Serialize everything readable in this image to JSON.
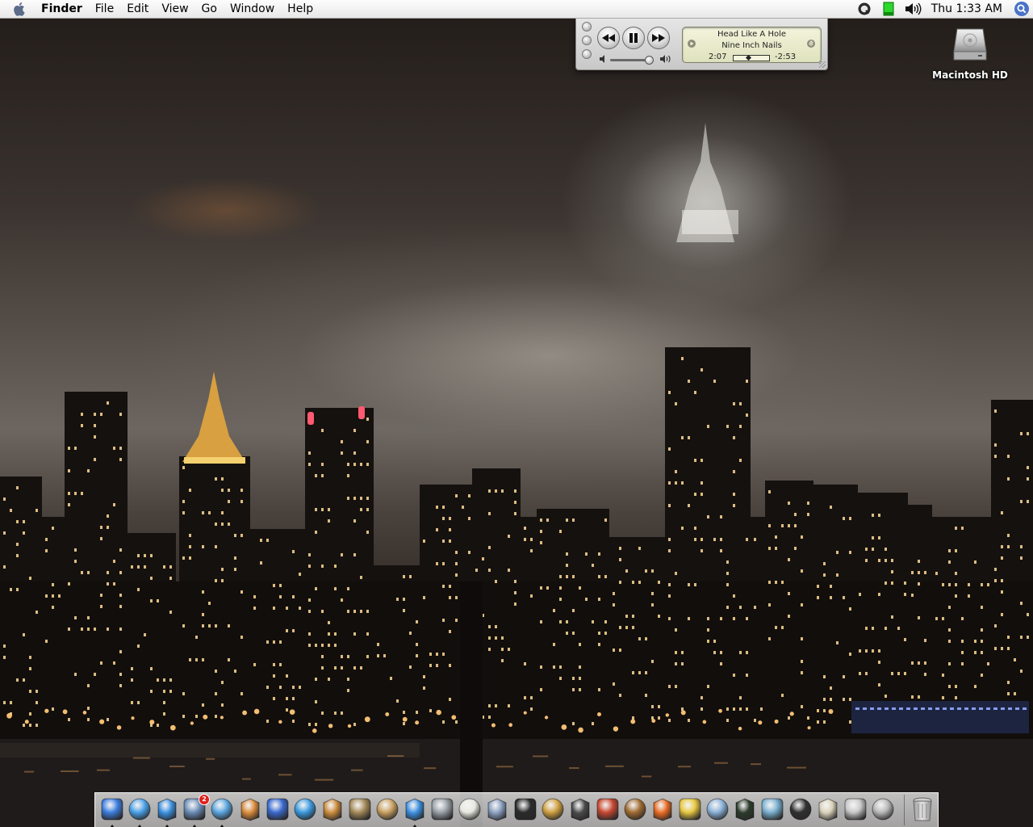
{
  "menubar": {
    "app_name": "Finder",
    "menus": [
      "File",
      "Edit",
      "View",
      "Go",
      "Window",
      "Help"
    ],
    "clock": "Thu 1:33 AM",
    "extras": [
      "quicktime-icon",
      "battery-icon",
      "volume-icon"
    ]
  },
  "itunes": {
    "song_title": "Head Like A Hole",
    "artist": "Nine Inch Nails",
    "time_elapsed": "2:07",
    "time_remaining": "-2:53",
    "progress_fraction": 0.42,
    "volume_fraction": 0.9
  },
  "desktop": {
    "icons": [
      {
        "label": "Macintosh HD",
        "icon": "hard-drive-icon"
      }
    ]
  },
  "dock": {
    "mail_badge": "2",
    "apps": [
      {
        "id": "finder",
        "icon": "finder-icon",
        "running": true,
        "color": "#3d7fe0"
      },
      {
        "id": "safari",
        "icon": "safari-compass-icon",
        "running": true,
        "color": "#4aa0e8"
      },
      {
        "id": "ichat",
        "icon": "ichat-bubble-icon",
        "running": true,
        "color": "#3a8fe0"
      },
      {
        "id": "mail",
        "icon": "mail-stamp-icon",
        "running": true,
        "color": "#6a8db8"
      },
      {
        "id": "itunes",
        "icon": "itunes-note-icon",
        "running": true,
        "color": "#5aa5e0"
      },
      {
        "id": "iphoto",
        "icon": "iphoto-icon",
        "running": false,
        "color": "#d98a3a"
      },
      {
        "id": "imovie",
        "icon": "imovie-clapper-icon",
        "running": false,
        "color": "#3a6ad0"
      },
      {
        "id": "idvd",
        "icon": "idvd-disc-icon",
        "running": false,
        "color": "#3a9ae0"
      },
      {
        "id": "garageband",
        "icon": "guitar-icon",
        "running": false,
        "color": "#c98a3a"
      },
      {
        "id": "preview",
        "icon": "preview-photos-icon",
        "running": false,
        "color": "#a68a5a"
      },
      {
        "id": "address-book",
        "icon": "address-book-icon",
        "running": false,
        "color": "#c9a060"
      },
      {
        "id": "quicktime",
        "icon": "quicktime-q-icon",
        "running": true,
        "color": "#3a8fe0"
      },
      {
        "id": "automator",
        "icon": "automator-robot-icon",
        "running": false,
        "color": "#9aa0a8"
      },
      {
        "id": "textedit",
        "icon": "textedit-icon",
        "running": false,
        "color": "#e8e8e0"
      },
      {
        "id": "photo-booth",
        "icon": "photos-icon",
        "running": false,
        "color": "#8aa0c0"
      },
      {
        "id": "terminal",
        "icon": "terminal-icon",
        "running": false,
        "color": "#2a2a2a"
      },
      {
        "id": "network-utility",
        "icon": "pencil-ruler-icon",
        "running": false,
        "color": "#d0a040"
      },
      {
        "id": "activity-tool",
        "icon": "film-icon",
        "running": false,
        "color": "#4a4a4a"
      },
      {
        "id": "disk-tool",
        "icon": "drill-icon",
        "running": false,
        "color": "#c84830"
      },
      {
        "id": "helm",
        "icon": "ships-wheel-icon",
        "running": false,
        "color": "#a06a30"
      },
      {
        "id": "fish",
        "icon": "goldfish-icon",
        "running": false,
        "color": "#e86a20"
      },
      {
        "id": "keychain",
        "icon": "keychain-icon",
        "running": false,
        "color": "#e8c840"
      },
      {
        "id": "system-profiler",
        "icon": "computer-icon",
        "running": false,
        "color": "#8ab0d8"
      },
      {
        "id": "activity-monitor",
        "icon": "activity-monitor-icon",
        "running": false,
        "color": "#2a3a2a"
      },
      {
        "id": "fish-2",
        "icon": "aquarium-fish-icon",
        "running": false,
        "color": "#7ab0d0"
      },
      {
        "id": "x11",
        "icon": "x11-icon",
        "running": false,
        "color": "#303030"
      },
      {
        "id": "installer",
        "icon": "package-icon",
        "running": false,
        "color": "#d8d0b8"
      },
      {
        "id": "boot-camp",
        "icon": "apple-box-icon",
        "running": false,
        "color": "#c8c8c8"
      },
      {
        "id": "utilities",
        "icon": "test-tube-icon",
        "running": false,
        "color": "#b8b8b8"
      }
    ],
    "trash": {
      "icon": "trash-icon"
    }
  }
}
